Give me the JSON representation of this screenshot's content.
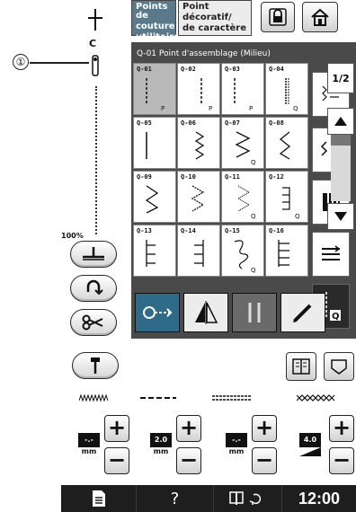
{
  "callout": {
    "number": "①"
  },
  "needle": {
    "letter": "C"
  },
  "zoom": {
    "percent": "100%"
  },
  "tabs": [
    {
      "label_lines": [
        "Points de",
        "couture",
        "utilitaires"
      ]
    },
    {
      "label_lines": [
        "Point",
        "décoratif/",
        "de caractère"
      ]
    }
  ],
  "panel": {
    "title": "Q-01  Point d'assemblage (Milieu)"
  },
  "stitches": [
    {
      "code": "Q-01",
      "selected": true
    },
    {
      "code": "Q-02"
    },
    {
      "code": "Q-03"
    },
    {
      "code": "Q-04"
    },
    {
      "code": "Q-05"
    },
    {
      "code": "Q-06"
    },
    {
      "code": "Q-07"
    },
    {
      "code": "Q-08"
    },
    {
      "code": "Q-09"
    },
    {
      "code": "Q-10"
    },
    {
      "code": "Q-11"
    },
    {
      "code": "Q-12"
    },
    {
      "code": "Q-13"
    },
    {
      "code": "Q-14"
    },
    {
      "code": "Q-15"
    },
    {
      "code": "Q-16"
    }
  ],
  "pagination": {
    "page": "1",
    "total": "2",
    "separator": "/"
  },
  "settings": {
    "width_display": "-.-",
    "width_unit": "mm",
    "length_value": "2.0",
    "length_unit": "mm",
    "tension_display": "-.-",
    "tension_unit": "mm",
    "density_value": "4.0"
  },
  "buttons": {
    "plus": "+",
    "minus": "−"
  },
  "status": {
    "help": "?",
    "time": "12:00"
  }
}
